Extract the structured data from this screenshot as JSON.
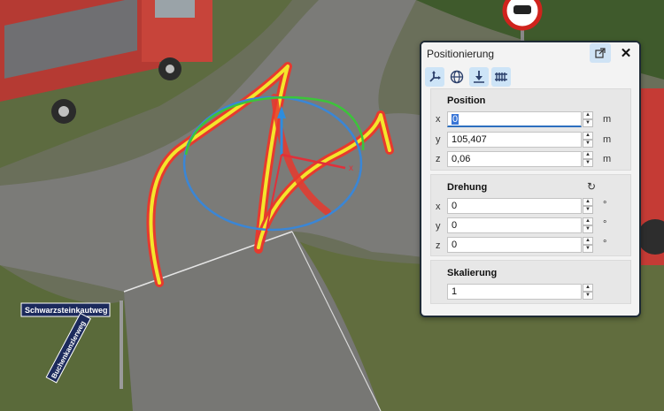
{
  "scene": {
    "street_sign_1": "Schwarzsteinkautweg",
    "street_sign_2": "Buchenkanzlerweg",
    "gizmo_axis_label": "x"
  },
  "panel": {
    "title": "Positionierung",
    "toolbar": [
      "move-axes-icon",
      "globe-icon",
      "snap-down-icon",
      "rail-icon"
    ],
    "position": {
      "heading": "Position",
      "rows": [
        {
          "axis": "x",
          "value": "0",
          "unit": "m"
        },
        {
          "axis": "y",
          "value": "105,407",
          "unit": "m"
        },
        {
          "axis": "z",
          "value": "0,06",
          "unit": "m"
        }
      ]
    },
    "rotation": {
      "heading": "Drehung",
      "rows": [
        {
          "axis": "x",
          "value": "0",
          "unit": "°"
        },
        {
          "axis": "y",
          "value": "0",
          "unit": "°"
        },
        {
          "axis": "z",
          "value": "0",
          "unit": "°"
        }
      ]
    },
    "scale": {
      "heading": "Skalierung",
      "value": "1"
    }
  },
  "colors": {
    "accent": "#3875d7",
    "highlight_red": "#e63a2e",
    "highlight_yellow": "#f4e62b"
  }
}
